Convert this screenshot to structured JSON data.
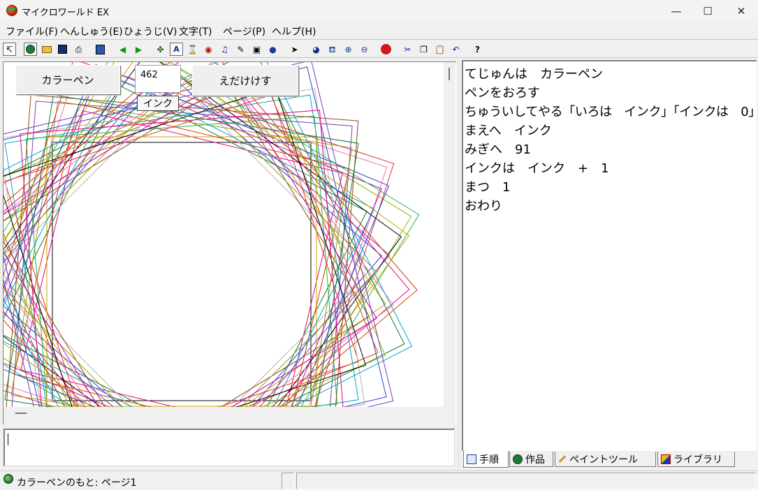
{
  "window": {
    "title": "マイクロワールド EX",
    "minimize": "—",
    "maximize": "☐",
    "close": "✕"
  },
  "menu": [
    "ファイル(F)",
    "へんしゅう(E)",
    "ひょうじ(V)",
    "文字(T)",
    "ページ(P)",
    "ヘルプ(H)"
  ],
  "toolbar": {
    "icons": [
      "pointer-icon",
      "globe-icon",
      "open-folder-icon",
      "save-icon",
      "print-icon",
      "page-layout-icon",
      "back-arrow-icon",
      "forward-arrow-icon",
      "new-turtle-icon",
      "text-box-icon",
      "hourglass-icon",
      "eye-icon",
      "music-note-icon",
      "brush-icon",
      "video-icon",
      "record-icon",
      "select-arrow-icon",
      "eye-view-icon",
      "stamp-icon",
      "zoom-in-icon",
      "zoom-out-icon",
      "stop-hand-icon",
      "cut-icon",
      "copy-icon",
      "paste-icon",
      "undo-icon",
      "help-icon"
    ],
    "help_label": "?"
  },
  "canvas": {
    "color_pen_button": "カラーペン",
    "ink_value": "462",
    "ink_label": "インク",
    "erase_button": "えだけけす"
  },
  "script": {
    "lines": [
      "てじゅんは　カラーペン",
      "ペンをおろす",
      "ちゅういしてやる「いろは　インク」「インクは　0」",
      "まえへ　インク",
      "みぎへ　91",
      "インクは　インク　+　1",
      "まつ　1",
      "おわり"
    ]
  },
  "tabs": [
    {
      "label": "手順",
      "active": true,
      "icon": "book-icon"
    },
    {
      "label": "作品",
      "active": false,
      "icon": "globe-icon"
    },
    {
      "label": "ペイントツール",
      "active": false,
      "icon": "paint-brush-icon"
    },
    {
      "label": "ライブラリ",
      "active": false,
      "icon": "shapes-icon"
    }
  ],
  "status": {
    "text": "カラーペンのもと: ページ1"
  },
  "drawing": {
    "turn_degrees": 91,
    "colors": [
      "#000000",
      "#e6007e",
      "#0a7d2c",
      "#2f3bd4",
      "#c8a400",
      "#d83a00",
      "#00a6c8",
      "#7a3db8",
      "#ff6aa2",
      "#8ab800",
      "#b0b0b0",
      "#8b4a1a",
      "#e03030",
      "#29b34a",
      "#9a9a00",
      "#c000c0"
    ]
  }
}
